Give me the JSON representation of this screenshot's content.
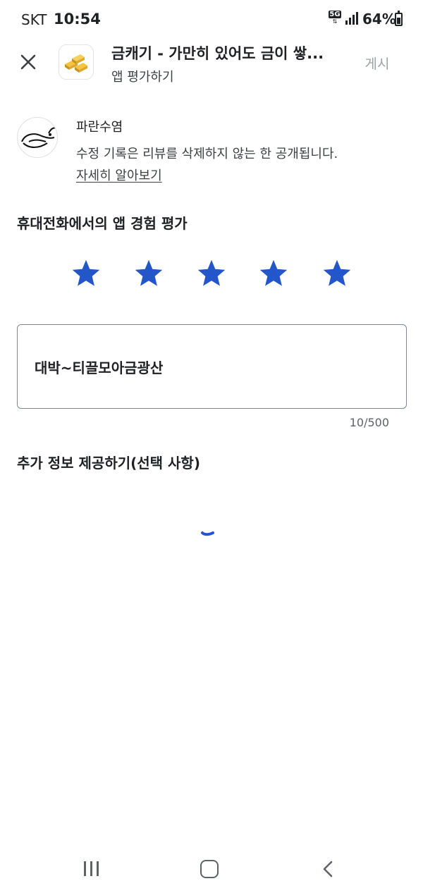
{
  "status_bar": {
    "carrier": "SKT",
    "time": "10:54",
    "network": "5G",
    "battery": "64%",
    "icons": [
      "5g-icon",
      "signal-icon",
      "battery-icon"
    ]
  },
  "header": {
    "app_title": "금캐기 - 가만히 있어도 금이 쌓...",
    "subtitle": "앱 평가하기",
    "post_label": "게시",
    "close_icon": "close-icon",
    "app_icon": "gold-bars-icon"
  },
  "user": {
    "name": "파란수염",
    "notice": "수정 기록은 리뷰를 삭제하지 않는 한 공개됩니다.",
    "learn_more": "자세히 알아보기"
  },
  "rating": {
    "title": "휴대전화에서의 앱 경험 평가",
    "value": 5,
    "max": 5,
    "star_color": "#2356c9"
  },
  "review": {
    "text": "대박~티끌모아금광산",
    "counter": "10/500"
  },
  "extra": {
    "title": "추가 정보 제공하기(선택 사항)",
    "loading": true
  },
  "colors": {
    "accent": "#2356c9",
    "disabled_text": "#9aa0a6",
    "border": "#80868b"
  }
}
